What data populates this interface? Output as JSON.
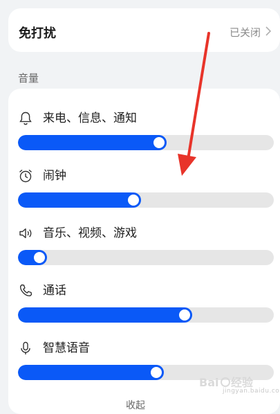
{
  "dnd": {
    "title": "免打扰",
    "status": "已关闭"
  },
  "volume": {
    "heading": "音量",
    "items": [
      {
        "label": "来电、信息、通知",
        "icon": "bell-icon",
        "level": 0.58
      },
      {
        "label": "闹钟",
        "icon": "alarm-clock-icon",
        "level": 0.48
      },
      {
        "label": "音乐、视频、游戏",
        "icon": "speaker-icon",
        "level": 0.1
      },
      {
        "label": "通话",
        "icon": "phone-icon",
        "level": 0.68
      },
      {
        "label": "智慧语音",
        "icon": "microphone-icon",
        "level": 0.57
      }
    ]
  },
  "collapse_label": "收起",
  "watermark": {
    "text": "jingyan.baidu.com"
  },
  "colors": {
    "accent": "#0a59f7",
    "track": "#e6e6e6",
    "annotation": "#e8342a"
  }
}
